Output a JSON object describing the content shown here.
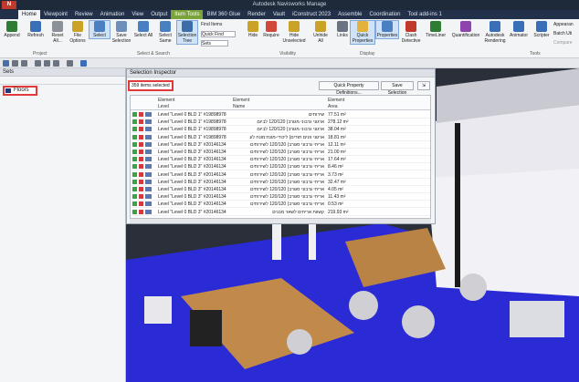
{
  "app": {
    "title": "Autodesk Navisworks Manage",
    "menu_button": "N"
  },
  "menu": {
    "tabs": [
      "Home",
      "Viewpoint",
      "Review",
      "Animation",
      "View",
      "Output",
      "Item Tools",
      "BIM 360 Glue",
      "Render",
      "Vault",
      "iConstruct 2023",
      "Assemble",
      "Coordination",
      "Tool add-ins 1"
    ]
  },
  "ribbon": {
    "buttons": [
      {
        "label": "Append",
        "icon": "append-icon"
      },
      {
        "label": "Refresh",
        "icon": "refresh-icon"
      },
      {
        "label": "Reset All...",
        "icon": "reset-all-icon"
      },
      {
        "label": "File Options",
        "icon": "file-options-icon"
      },
      {
        "label": "Select",
        "icon": "select-icon"
      },
      {
        "label": "Save Selection",
        "icon": "save-selection-icon"
      },
      {
        "label": "Select All",
        "icon": "select-all-icon"
      },
      {
        "label": "Select Same",
        "icon": "select-same-icon"
      },
      {
        "label": "Selection Tree",
        "icon": "selection-tree-icon"
      },
      {
        "label": "Hide",
        "icon": "hide-icon"
      },
      {
        "label": "Require",
        "icon": "require-icon"
      },
      {
        "label": "Hide Unselected",
        "icon": "hide-unselected-icon"
      },
      {
        "label": "Unhide All",
        "icon": "unhide-all-icon"
      },
      {
        "label": "Links",
        "icon": "links-icon"
      },
      {
        "label": "Quick Properties",
        "icon": "quick-properties-icon"
      },
      {
        "label": "Properties",
        "icon": "properties-icon"
      },
      {
        "label": "Clash Detective",
        "icon": "clash-detective-icon"
      },
      {
        "label": "TimeLiner",
        "icon": "timeliner-icon"
      },
      {
        "label": "Quantification",
        "icon": "quantification-icon"
      },
      {
        "label": "Autodesk Rendering",
        "icon": "rendering-icon"
      },
      {
        "label": "Animator",
        "icon": "animator-icon"
      },
      {
        "label": "Scripter",
        "icon": "scripter-icon"
      }
    ],
    "small_items": {
      "find_items": "Find Items",
      "quick_find": "Quick Find",
      "sets": "Sets",
      "appearance": "Appearan",
      "batch": "Batch Uti",
      "compare": "Compare"
    },
    "groups": {
      "project": "Project",
      "select_search": "Select & Search",
      "visibility": "Visibility",
      "display": "Display",
      "tools": "Tools"
    }
  },
  "sets_panel": {
    "title": "Sets",
    "item": "Floors"
  },
  "inspector": {
    "title": "Selection Inspector",
    "count": "359 items selected",
    "quick_button": "Quick Property Definitions...",
    "save_button": "Save Selection",
    "columns": [
      {
        "top": "Element",
        "bottom": "Level"
      },
      {
        "top": "Element",
        "bottom": "Name"
      },
      {
        "top": "Element",
        "bottom": "Area"
      }
    ],
    "rows": [
      {
        "level": "Level \"Level 0 BLD 1\" #19898978",
        "name": "שירותים",
        "area": "77.51 m²"
      },
      {
        "level": "Level \"Level 0 BLD 1\" #19898978",
        "name": "ארגוני גרבוני מגורב) 120/120 לביום",
        "area": "278.12 m²"
      },
      {
        "level": "Level \"Level 0 BLD 1\" #19898978",
        "name": "ארגוני גרבוני מגורב) 120/120 לביום",
        "area": "38.04 m²"
      },
      {
        "level": "Level \"Level 0 BLD 1\" #19898978",
        "name": "ארגוני פנים תודים) ליכודי-מונח:מונח לע",
        "area": "18.81 m²"
      },
      {
        "level": "Level \"Level 0 BLD 3\" #20146134",
        "name": "אריחי גרבוני סגורב) 120/120 לשירותים",
        "area": "12.11 m²"
      },
      {
        "level": "Level \"Level 0 BLD 3\" #20146134",
        "name": "אריחי גרבוני סגורב) 120/120 לשירותים",
        "area": "21.00 m²"
      },
      {
        "level": "Level \"Level 0 BLD 3\" #20146134",
        "name": "אריחי גרבוני סגורב) 120/120 לשירותים",
        "area": "17.64 m²"
      },
      {
        "level": "Level \"Level 0 BLD 3\" #20146134",
        "name": "אריחי גרבוני סגורב) 120/120 לשירותים",
        "area": "8.46 m²"
      },
      {
        "level": "Level \"Level 0 BLD 3\" #20146134",
        "name": "אריחי גרבוני סגורב) 120/120 לשירותים",
        "area": "3.73 m²"
      },
      {
        "level": "Level \"Level 0 BLD 3\" #20146134",
        "name": "אריחי גרבוני סגורב) 120/120 לשירותים",
        "area": "32.47 m²"
      },
      {
        "level": "Level \"Level 0 BLD 3\" #20146134",
        "name": "אריחי גרבוני סגורב) 120/120 לשירותים",
        "area": "4.05 m²"
      },
      {
        "level": "Level \"Level 0 BLD 3\" #20146134",
        "name": "אריחי גרבוני סגורב) 120/120 לשירותים",
        "area": "11.43 m²"
      },
      {
        "level": "Level \"Level 0 BLD 3\" #20146134",
        "name": "אריחי גרבוני סגורב) 120/120 לשירותים",
        "area": "0.53 m²"
      },
      {
        "level": "Level \"Level 0 BLD 3\" #20146134",
        "name": "קשוות אריחים לשאר מבנים",
        "area": "219.93 m²"
      }
    ]
  }
}
